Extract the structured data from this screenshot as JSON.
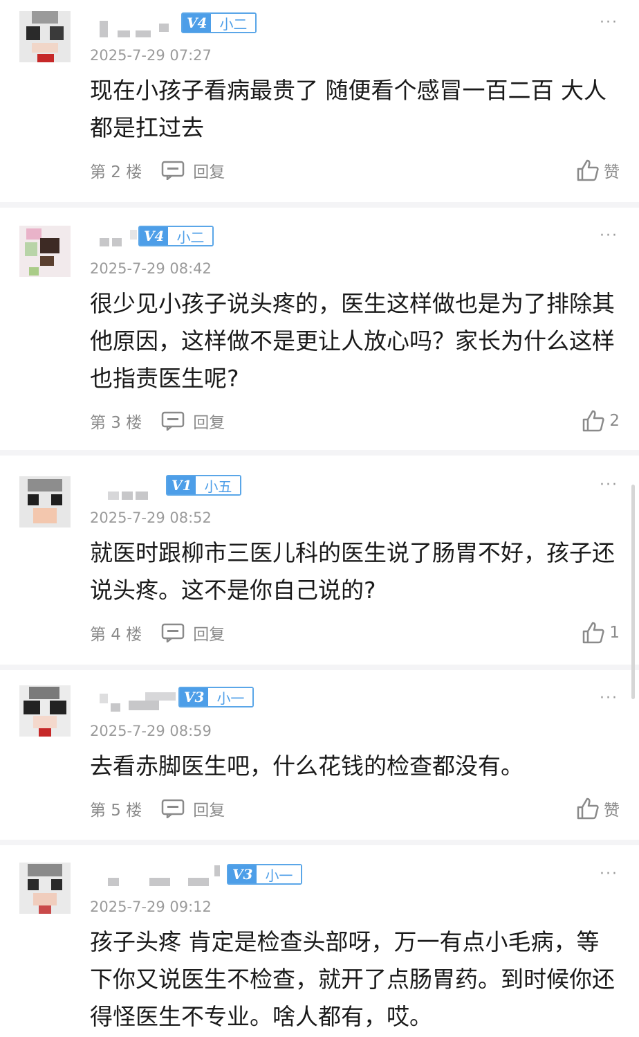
{
  "comments": [
    {
      "level": "V4",
      "title": "小二",
      "time": "2025-7-29 07:27",
      "text": "现在小孩子看病最贵了 随便看个感冒一百二百 大人都是扛过去",
      "floor": "第 2 楼",
      "reply": "回复",
      "like": "赞"
    },
    {
      "level": "V4",
      "title": "小二",
      "time": "2025-7-29 08:42",
      "text": "很少见小孩子说头疼的，医生这样做也是为了排除其他原因，这样做不是更让人放心吗？家长为什么这样也指责医生呢?",
      "floor": "第 3 楼",
      "reply": "回复",
      "like": "2"
    },
    {
      "level": "V1",
      "title": "小五",
      "time": "2025-7-29 08:52",
      "text": "就医时跟柳市三医儿科的医生说了肠胃不好，孩子还说头疼。这不是你自己说的?",
      "floor": "第 4 楼",
      "reply": "回复",
      "like": "1"
    },
    {
      "level": "V3",
      "title": "小一",
      "time": "2025-7-29 08:59",
      "text": "去看赤脚医生吧，什么花钱的检查都没有。",
      "floor": "第 5 楼",
      "reply": "回复",
      "like": "赞"
    },
    {
      "level": "V3",
      "title": "小一",
      "time": "2025-7-29 09:12",
      "text": "孩子头疼 肯定是检查头部呀，万一有点小毛病，等下你又说医生不检查，就开了点肠胃药。到时候你还得怪医生不专业。啥人都有，哎。",
      "floor": "",
      "reply": "",
      "like": ""
    }
  ],
  "more_label": "···",
  "colors": {
    "accent": "#4d9ee8",
    "muted": "#9b9b9b",
    "text": "#1a1a1a"
  }
}
